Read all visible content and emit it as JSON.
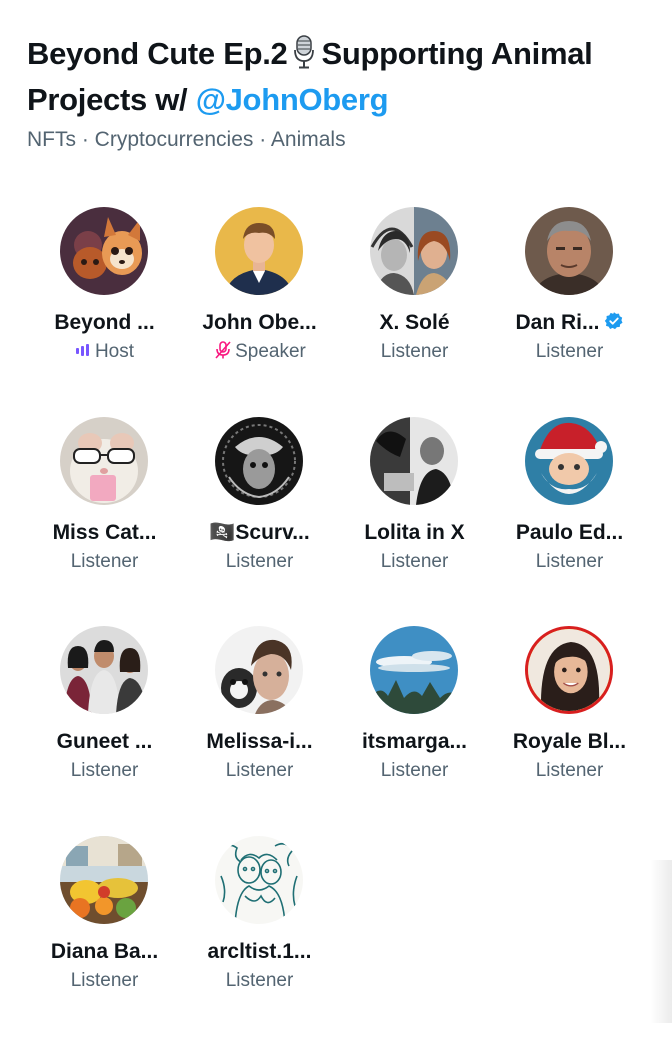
{
  "space": {
    "title_part1": "Beyond Cute Ep.2",
    "title_part2": "Supporting Animal Projects w/ ",
    "mention": "@JohnOberg",
    "title_icon": "microphone-icon",
    "topics": "NFTs · Cryptocurrencies · Animals"
  },
  "participants": [
    {
      "name": "Beyond ...",
      "role": "Host",
      "role_icon": "host-bars-icon"
    },
    {
      "name": "John Obe...",
      "role": "Speaker",
      "role_icon": "mic-muted-icon"
    },
    {
      "name": "X. Solé",
      "role": "Listener"
    },
    {
      "name": "Dan Ri...",
      "role": "Listener",
      "badge": "verified-badge-icon"
    },
    {
      "name": "Miss Cat...",
      "role": "Listener"
    },
    {
      "name": "🏴‍☠️Scurv...",
      "role": "Listener"
    },
    {
      "name": "Lolita in X",
      "role": "Listener"
    },
    {
      "name": "Paulo Ed...",
      "role": "Listener"
    },
    {
      "name": "Guneet ...",
      "role": "Listener"
    },
    {
      "name": "Melissa-i...",
      "role": "Listener"
    },
    {
      "name": "itsmarga...",
      "role": "Listener"
    },
    {
      "name": "Royale Bl...",
      "role": "Listener"
    },
    {
      "name": "Diana Ba...",
      "role": "Listener"
    },
    {
      "name": "arcltist.1...",
      "role": "Listener"
    }
  ],
  "colors": {
    "text": "#0f1419",
    "secondary": "#536471",
    "accent": "#1d9bf0",
    "host_purple": "#7856ff",
    "speaker_pink": "#f91880"
  }
}
